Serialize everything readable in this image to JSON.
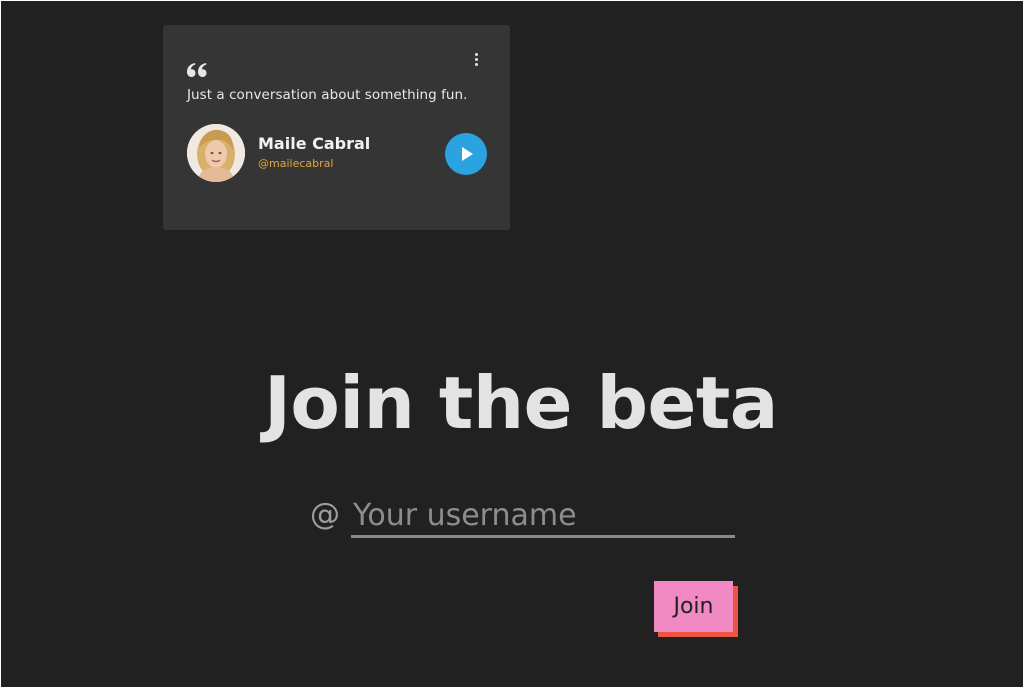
{
  "testimonial": {
    "quote": "Just a conversation about something fun.",
    "author_name": "Maile Cabral",
    "author_handle": "@mailecabral",
    "menu_icon": "kebab-menu-icon",
    "quote_icon": "quote-mark-icon",
    "play_icon": "play-icon"
  },
  "signup": {
    "heading": "Join the beta",
    "at_prefix": "@",
    "username_placeholder": "Your username",
    "join_label": "Join"
  },
  "colors": {
    "background": "#212121",
    "card": "#353535",
    "handle": "#e0a93a",
    "play": "#2aa3e0",
    "button": "#f089c4",
    "button_shadow": "#ee5540"
  }
}
